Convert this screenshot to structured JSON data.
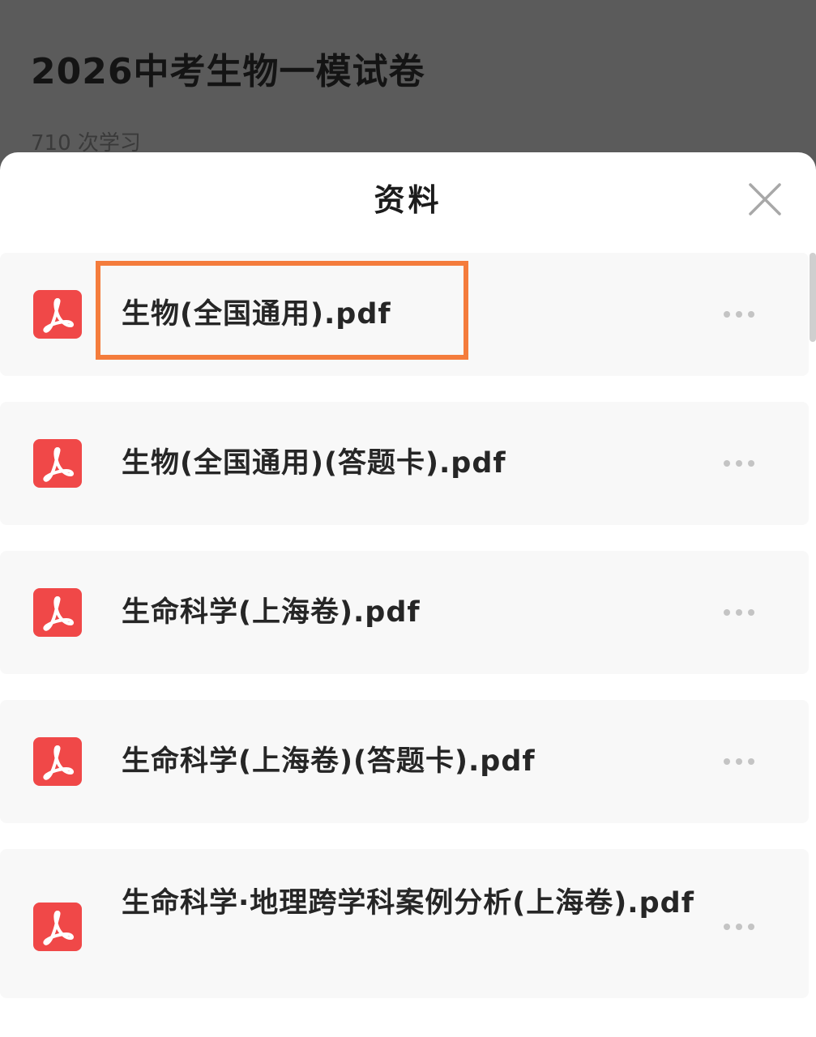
{
  "page": {
    "title": "2026中考生物一模试卷",
    "meta": "710 次学习"
  },
  "sheet": {
    "title": "资料",
    "close_icon": "close-icon"
  },
  "files": [
    {
      "name": "生物(全国通用).pdf",
      "icon": "pdf-icon",
      "highlighted": true
    },
    {
      "name": "生物(全国通用)(答题卡).pdf",
      "icon": "pdf-icon"
    },
    {
      "name": "生命科学(上海卷).pdf",
      "icon": "pdf-icon"
    },
    {
      "name": "生命科学(上海卷)(答题卡).pdf",
      "icon": "pdf-icon"
    },
    {
      "name": "生命科学·地理跨学科案例分析(上海卷).pdf",
      "icon": "pdf-icon"
    }
  ],
  "colors": {
    "pdf_red": "#f04848",
    "highlight_orange": "#f47c3c",
    "overlay_gray": "#5b5b5b"
  }
}
